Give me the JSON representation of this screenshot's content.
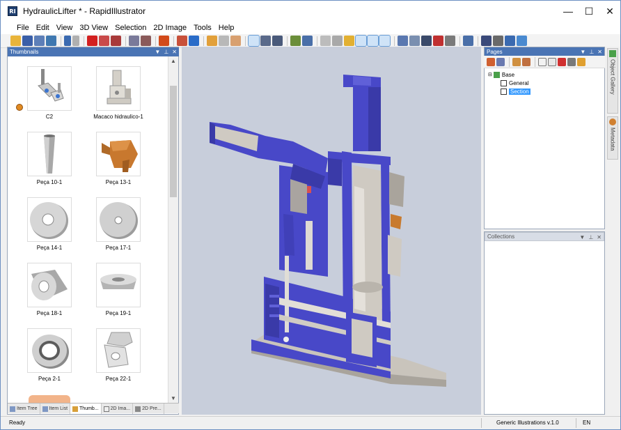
{
  "window": {
    "title": "HydraulicLifter * - RapidIllustrator",
    "app_icon_text": "RI",
    "minimize": "—",
    "maximize": "☐",
    "close": "✕"
  },
  "menu": [
    "File",
    "Edit",
    "View",
    "3D View",
    "Selection",
    "2D Image",
    "Tools",
    "Help"
  ],
  "thumbnails_panel": {
    "title": "Thumbnails",
    "items": [
      {
        "label": "C2",
        "icon": "assembly-thumbnail"
      },
      {
        "label": "Macaco hidraulico-1",
        "icon": "jack-thumbnail"
      },
      {
        "label": "Peça 10-1",
        "icon": "tube-thumbnail"
      },
      {
        "label": "Peça 13-1",
        "icon": "handle-thumbnail"
      },
      {
        "label": "Peça 14-1",
        "icon": "washer-thumbnail"
      },
      {
        "label": "Peça 17-1",
        "icon": "washer-thumbnail"
      },
      {
        "label": "Peça 18-1",
        "icon": "cylinder-ring-thumbnail"
      },
      {
        "label": "Peça 19-1",
        "icon": "flat-ring-thumbnail"
      },
      {
        "label": "Peça 2-1",
        "icon": "thick-ring-thumbnail"
      },
      {
        "label": "Peça 22-1",
        "icon": "fitting-thumbnail"
      }
    ]
  },
  "bottom_tabs": [
    "Item Tree",
    "Item List",
    "Thumb...",
    "2D Ima...",
    "2D Pre..."
  ],
  "pages_panel": {
    "title": "Pages",
    "tree": [
      {
        "label": "Base",
        "level": 0
      },
      {
        "label": "General",
        "level": 1
      },
      {
        "label": "Section",
        "level": 1,
        "selected": true
      }
    ]
  },
  "collections_panel": {
    "title": "Collections"
  },
  "side_tabs": [
    "Object Gallery",
    "Metadata"
  ],
  "status": {
    "left": "Ready",
    "middle": "Generic Illustrations v.1.0",
    "lang": "EN"
  },
  "colors": {
    "panel_header": "#4a74b4",
    "section_blue": "#4848c8",
    "section_gray": "#c9c4bc",
    "selection": "#3399ff"
  }
}
